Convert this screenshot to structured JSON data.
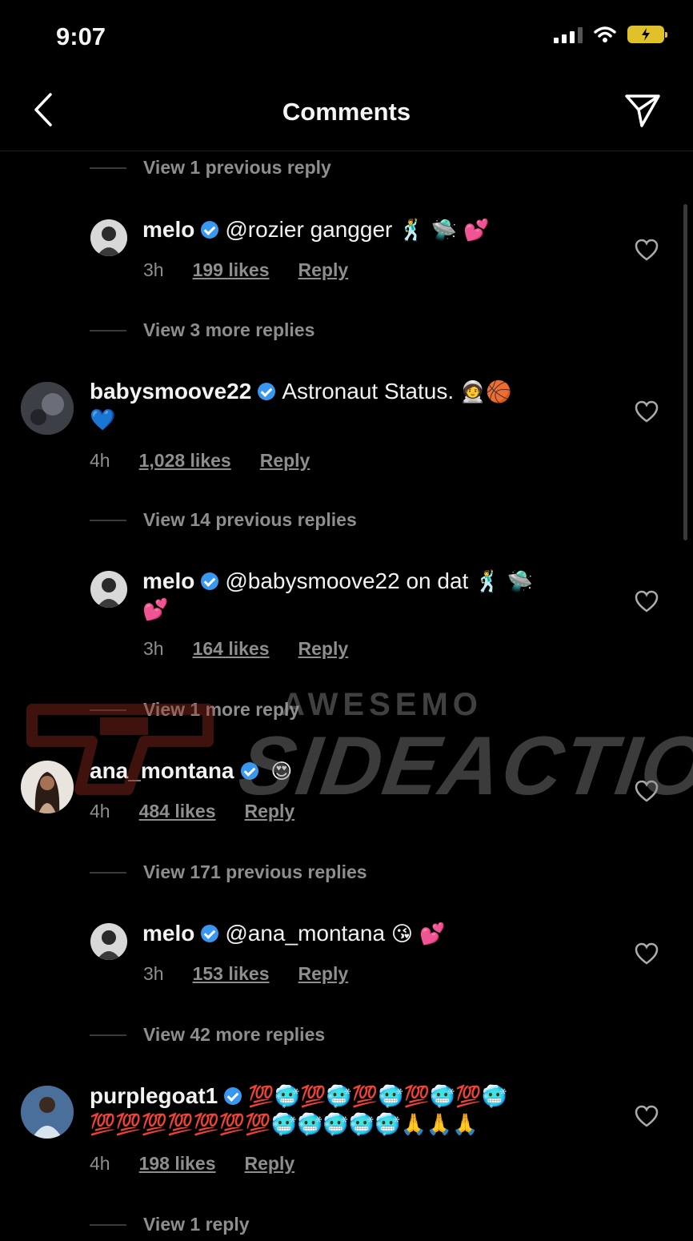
{
  "status_bar": {
    "time": "9:07"
  },
  "header": {
    "title": "Comments"
  },
  "items": {
    "v1": "View 1 previous reply",
    "c1": {
      "user": "melo",
      "text": "@rozier gangger",
      "emoji": "🕺 🛸 💕",
      "time": "3h",
      "likes": "199 likes",
      "reply": "Reply"
    },
    "v2": "View 3 more replies",
    "c2": {
      "user": "babysmoove22",
      "text": "Astronaut Status.",
      "emoji": "🧑‍🚀🏀",
      "emoji2": "💙",
      "time": "4h",
      "likes": "1,028 likes",
      "reply": "Reply"
    },
    "v3": "View 14 previous replies",
    "c3": {
      "user": "melo",
      "text": "@babysmoove22 on dat",
      "emoji": "🕺 🛸",
      "emoji2": "💕",
      "time": "3h",
      "likes": "164 likes",
      "reply": "Reply"
    },
    "v4": "View 1 more reply",
    "c4": {
      "user": "ana_montana",
      "emoji": "😍",
      "time": "4h",
      "likes": "484 likes",
      "reply": "Reply"
    },
    "v5": "View 171 previous replies",
    "c5": {
      "user": "melo",
      "text": "@ana_montana",
      "emoji": "😘 💕",
      "time": "3h",
      "likes": "153 likes",
      "reply": "Reply"
    },
    "v6": "View 42 more replies",
    "c6": {
      "user": "purplegoat1",
      "emoji": "💯🥶💯🥶💯🥶💯🥶💯🥶",
      "emoji2": "💯💯💯💯💯💯💯🥶🥶🥶🥶🥶🙏🙏🙏",
      "time": "4h",
      "likes": "198 likes",
      "reply": "Reply"
    },
    "v7": "View 1 reply"
  },
  "watermark": {
    "top": "AWESEMO",
    "main": "SIDEACTION"
  },
  "icons": [
    "back-chevron-icon",
    "send-icon",
    "heart-icon",
    "verified-badge-icon",
    "wifi-icon",
    "signal-icon",
    "battery-icon"
  ],
  "colors": {
    "background": "#000000",
    "secondary_text": "#8e8e8e",
    "verified": "#3897f0",
    "battery": "#e0c12a"
  }
}
